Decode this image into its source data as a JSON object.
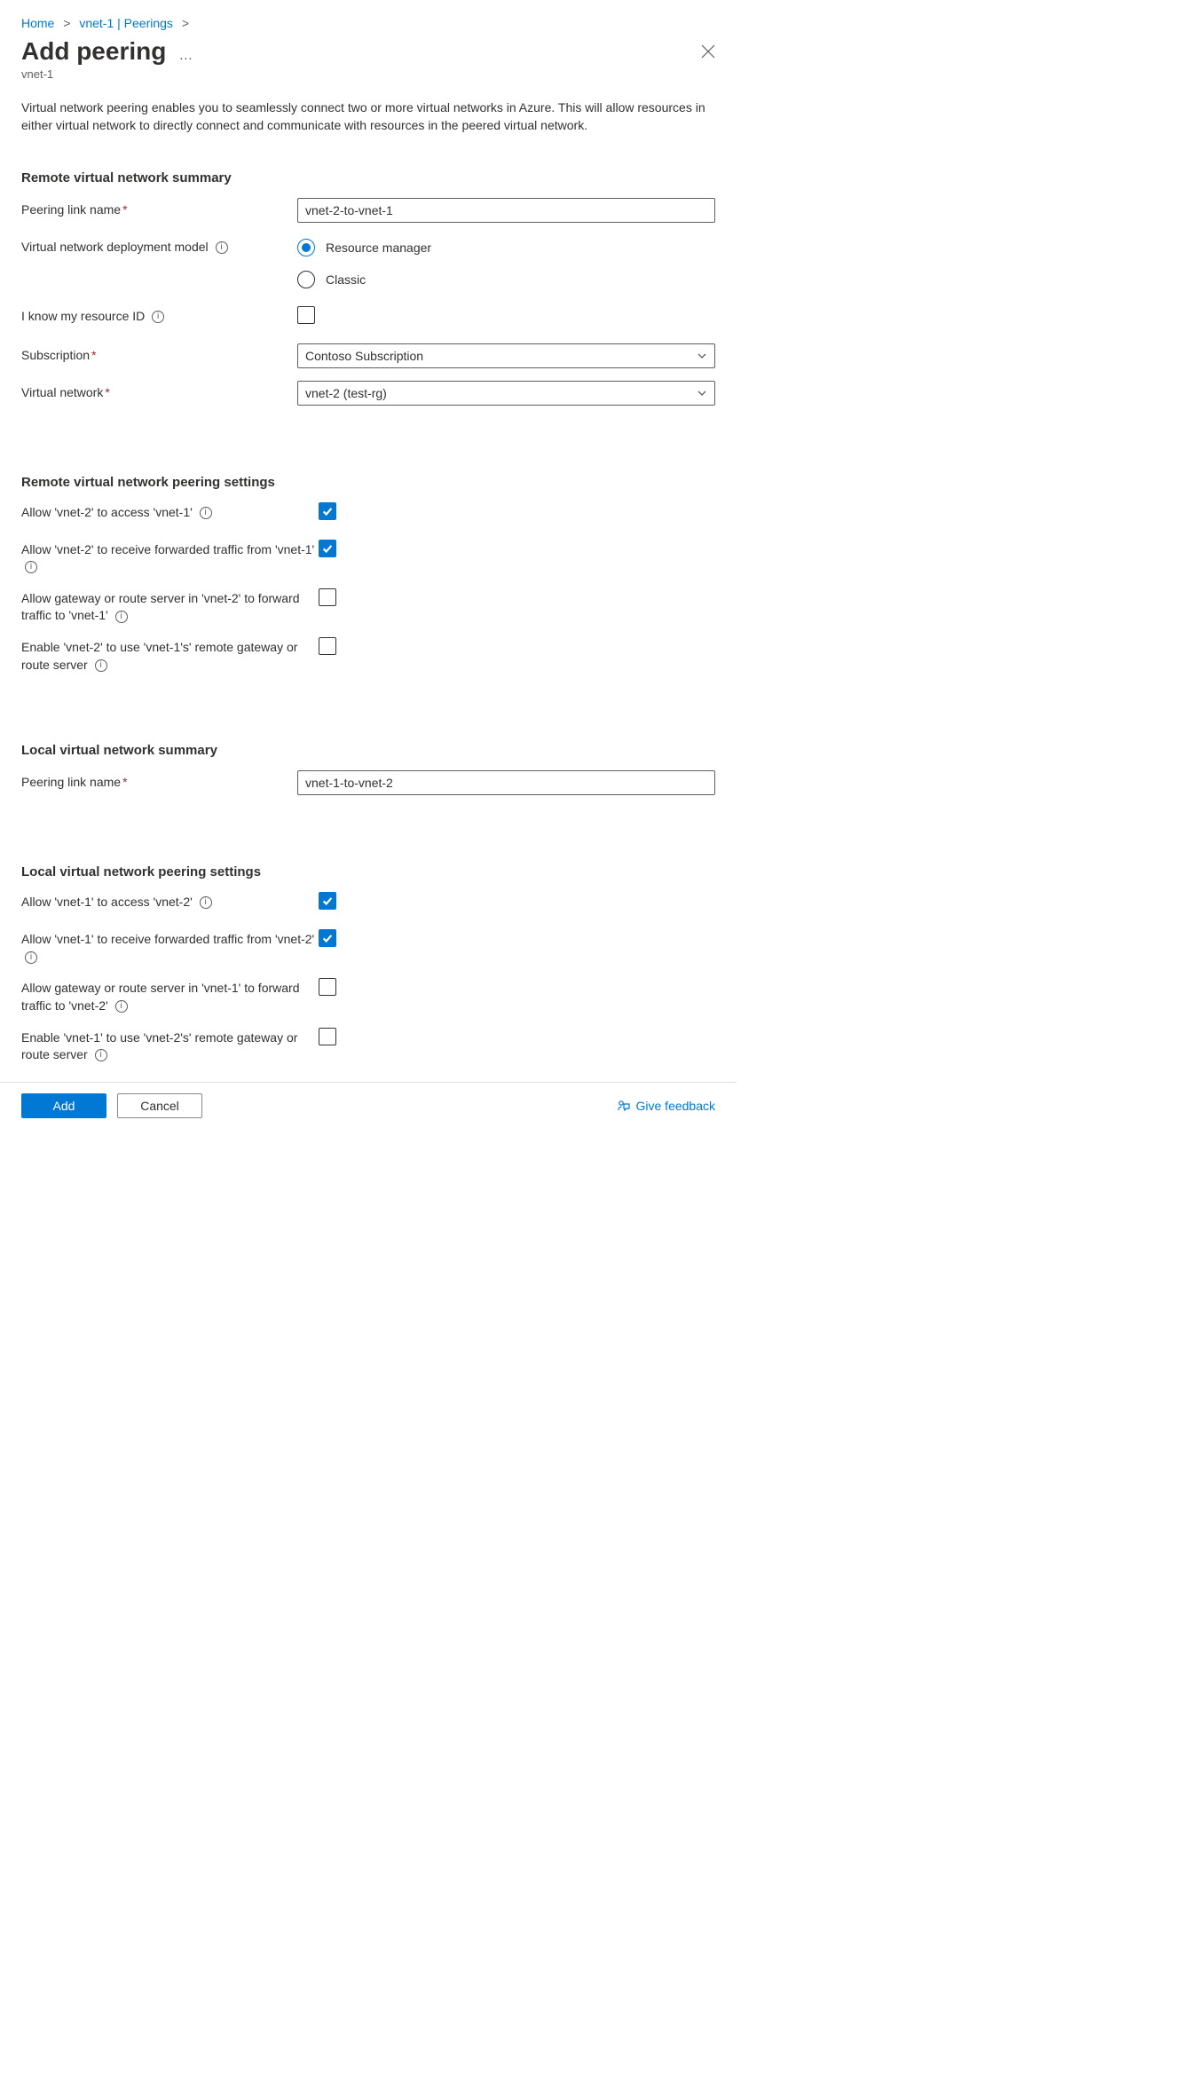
{
  "breadcrumb": {
    "home": "Home",
    "item1": "vnet-1 | Peerings"
  },
  "header": {
    "title": "Add peering",
    "subtitle": "vnet-1"
  },
  "description": "Virtual network peering enables you to seamlessly connect two or more virtual networks in Azure. This will allow resources in either virtual network to directly connect and communicate with resources in the peered virtual network.",
  "sections": {
    "remoteSummary": {
      "heading": "Remote virtual network summary",
      "peeringLinkLabel": "Peering link name",
      "peeringLinkValue": "vnet-2-to-vnet-1",
      "deployModelLabel": "Virtual network deployment model",
      "deployOptions": {
        "rm": "Resource manager",
        "classic": "Classic"
      },
      "resourceIdLabel": "I know my resource ID",
      "subscriptionLabel": "Subscription",
      "subscriptionValue": "Contoso Subscription",
      "vnetLabel": "Virtual network",
      "vnetValue": "vnet-2 (test-rg)"
    },
    "remotePeering": {
      "heading": "Remote virtual network peering settings",
      "allowAccess": "Allow 'vnet-2' to access 'vnet-1'",
      "allowForwarded": "Allow 'vnet-2' to receive forwarded traffic from 'vnet-1'",
      "allowGateway": "Allow gateway or route server in 'vnet-2' to forward traffic to 'vnet-1'",
      "useRemoteGateway": "Enable 'vnet-2' to use 'vnet-1's' remote gateway or route server"
    },
    "localSummary": {
      "heading": "Local virtual network summary",
      "peeringLinkLabel": "Peering link name",
      "peeringLinkValue": "vnet-1-to-vnet-2"
    },
    "localPeering": {
      "heading": "Local virtual network peering settings",
      "allowAccess": "Allow 'vnet-1' to access 'vnet-2'",
      "allowForwarded": "Allow 'vnet-1' to receive forwarded traffic from 'vnet-2'",
      "allowGateway": "Allow gateway or route server in 'vnet-1' to forward traffic to 'vnet-2'",
      "useRemoteGateway": "Enable 'vnet-1' to use 'vnet-2's' remote gateway or route server"
    }
  },
  "footer": {
    "add": "Add",
    "cancel": "Cancel",
    "feedback": "Give feedback"
  }
}
